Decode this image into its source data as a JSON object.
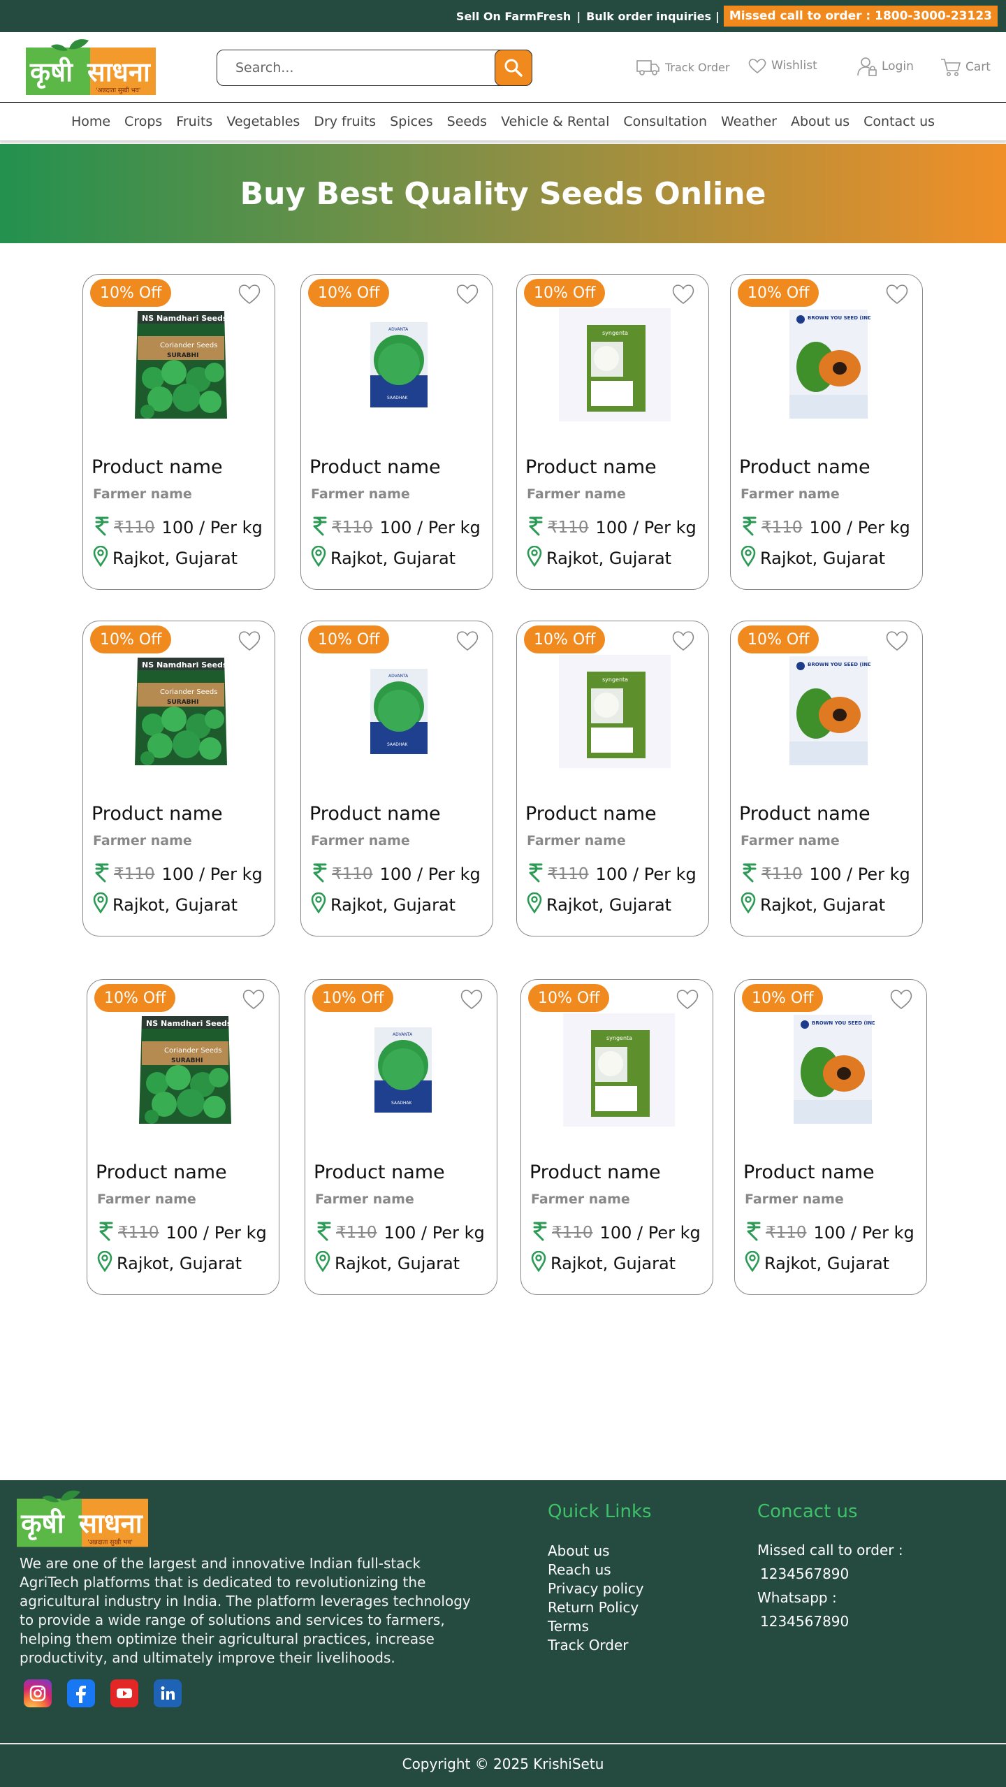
{
  "topbar": {
    "sell": "Sell On FarmFresh",
    "bulk": "Bulk order inquiries",
    "sep": "|",
    "missed_call": "Missed call to order : 1800-3000-23123"
  },
  "header": {
    "logo_text": "कृषीसाधना",
    "logo_tagline": "'अन्नदाता सुखी भव'",
    "search_placeholder": "Search...",
    "track_order": "Track Order",
    "wishlist": "Wishlist",
    "login": "Login",
    "cart": "Cart"
  },
  "nav": [
    "Home",
    "Crops",
    "Fruits",
    "Vegetables",
    "Dry fruits",
    "Spices",
    "Seeds",
    "Vehicle & Rental",
    "Consultation",
    "Weather",
    "About us",
    "Contact us"
  ],
  "banner": {
    "title": "Buy Best Quality Seeds Online"
  },
  "products": [
    {
      "badge": "10% Off",
      "name": "Product name",
      "farmer": "Farmer name",
      "old_price": "₹110",
      "price": "100 / Per kg",
      "location": "Rajkot, Gujarat",
      "image": "coriander-seed-pack"
    },
    {
      "badge": "10% Off",
      "name": "Product name",
      "farmer": "Farmer name",
      "old_price": "₹110",
      "price": "100 / Per kg",
      "location": "Rajkot, Gujarat",
      "image": "green-seed-pack"
    },
    {
      "badge": "10% Off",
      "name": "Product name",
      "farmer": "Farmer name",
      "old_price": "₹110",
      "price": "100 / Per kg",
      "location": "Rajkot, Gujarat",
      "image": "cauliflower-seed-pack"
    },
    {
      "badge": "10% Off",
      "name": "Product name",
      "farmer": "Farmer name",
      "old_price": "₹110",
      "price": "100 / Per kg",
      "location": "Rajkot, Gujarat",
      "image": "papaya-seed-pack"
    },
    {
      "badge": "10% Off",
      "name": "Product name",
      "farmer": "Farmer name",
      "old_price": "₹110",
      "price": "100 / Per kg",
      "location": "Rajkot, Gujarat",
      "image": "coriander-seed-pack"
    },
    {
      "badge": "10% Off",
      "name": "Product name",
      "farmer": "Farmer name",
      "old_price": "₹110",
      "price": "100 / Per kg",
      "location": "Rajkot, Gujarat",
      "image": "green-seed-pack"
    },
    {
      "badge": "10% Off",
      "name": "Product name",
      "farmer": "Farmer name",
      "old_price": "₹110",
      "price": "100 / Per kg",
      "location": "Rajkot, Gujarat",
      "image": "cauliflower-seed-pack"
    },
    {
      "badge": "10% Off",
      "name": "Product name",
      "farmer": "Farmer name",
      "old_price": "₹110",
      "price": "100 / Per kg",
      "location": "Rajkot, Gujarat",
      "image": "papaya-seed-pack"
    },
    {
      "badge": "10% Off",
      "name": "Product name",
      "farmer": "Farmer name",
      "old_price": "₹110",
      "price": "100 / Per kg",
      "location": "Rajkot, Gujarat",
      "image": "coriander-seed-pack"
    },
    {
      "badge": "10% Off",
      "name": "Product name",
      "farmer": "Farmer name",
      "old_price": "₹110",
      "price": "100 / Per kg",
      "location": "Rajkot, Gujarat",
      "image": "green-seed-pack"
    },
    {
      "badge": "10% Off",
      "name": "Product name",
      "farmer": "Farmer name",
      "old_price": "₹110",
      "price": "100 / Per kg",
      "location": "Rajkot, Gujarat",
      "image": "cauliflower-seed-pack"
    },
    {
      "badge": "10% Off",
      "name": "Product name",
      "farmer": "Farmer name",
      "old_price": "₹110",
      "price": "100 / Per kg",
      "location": "Rajkot, Gujarat",
      "image": "papaya-seed-pack"
    }
  ],
  "footer": {
    "about": "We are one of the largest and innovative Indian full-stack AgriTech platforms that is dedicated to revolutionizing the agricultural industry in India. The platform leverages technology to provide a wide range of solutions and services to farmers, helping them optimize their agricultural practices, increase productivity, and ultimately improve their livelihoods.",
    "quick_links_title": "Quick Links",
    "quick_links": [
      "About us",
      "Reach us",
      "Privacy policy",
      "Return Policy",
      "Terms",
      "Track Order"
    ],
    "contact_title": "Concact us",
    "missed_label": "Missed call to order :",
    "missed_number": "1234567890",
    "whatsapp_label": "Whatsapp :",
    "whatsapp_number": "1234567890",
    "social": [
      "instagram-icon",
      "facebook-icon",
      "youtube-icon",
      "linkedin-icon"
    ],
    "copyright": "Copyright © 2025 KrishiSetu"
  },
  "colors": {
    "dark_green": "#254a3f",
    "orange": "#f08a1f",
    "accent_green": "#3ec16a",
    "rupee_green": "#2a9a55"
  }
}
